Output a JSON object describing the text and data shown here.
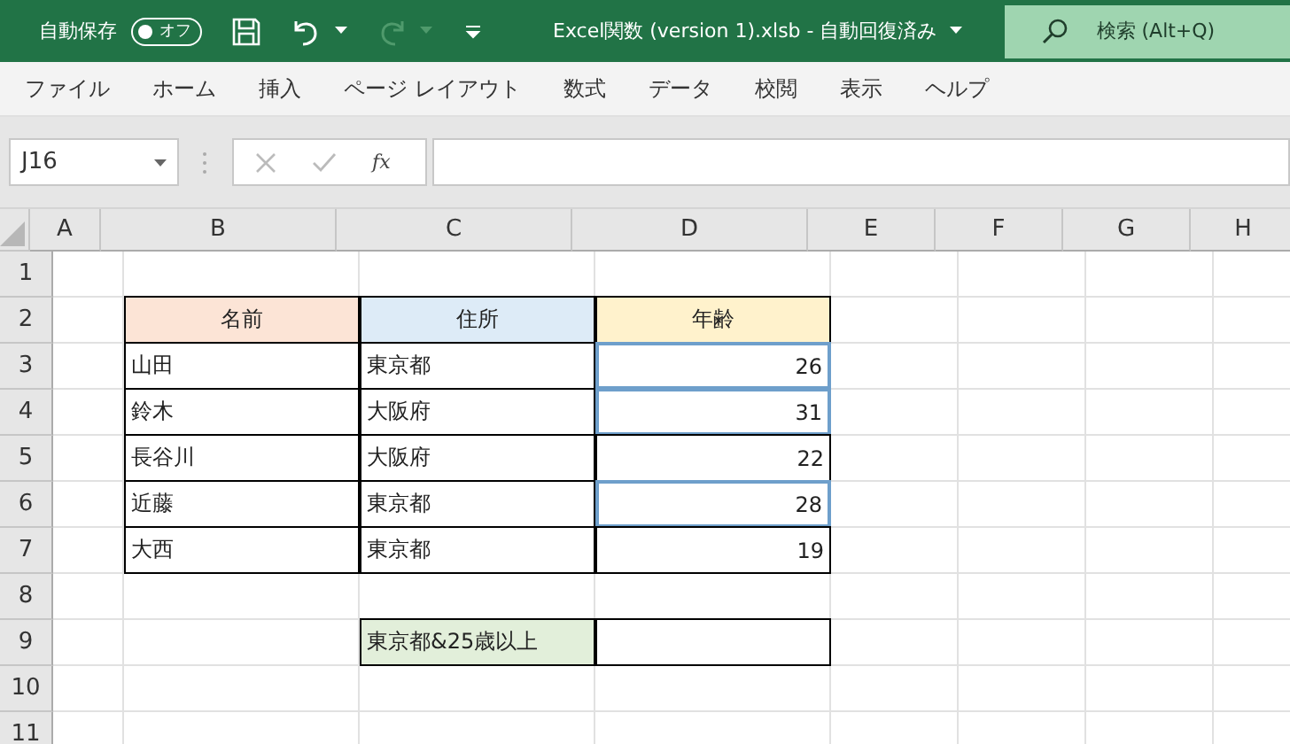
{
  "title_bar": {
    "autosave": {
      "label": "自動保存",
      "on": false,
      "state_text": "オフ"
    },
    "redo": {
      "disabled": true
    },
    "title": "Excel関数 (version 1).xlsb  -  自動回復済み",
    "search": {
      "placeholder": "検索 (Alt+Q)"
    }
  },
  "ribbon_tabs": [
    "ファイル",
    "ホーム",
    "挿入",
    "ページ レイアウト",
    "数式",
    "データ",
    "校閲",
    "表示",
    "ヘルプ"
  ],
  "formula_bar": {
    "name_box": "J16",
    "function_button": "fx"
  },
  "sheet": {
    "columns": [
      "A",
      "B",
      "C",
      "D",
      "E",
      "F",
      "G",
      "H"
    ],
    "row_labels": [
      "1",
      "2",
      "3",
      "4",
      "5",
      "6",
      "7",
      "8",
      "9",
      "10",
      "11"
    ],
    "table": {
      "header": [
        {
          "text": "名前",
          "color": "#fce4d6"
        },
        {
          "text": "住所",
          "color": "#ddebf7"
        },
        {
          "text": "年齢",
          "color": "#fff2cc"
        }
      ],
      "rows": [
        {
          "name": "山田",
          "address": "東京都",
          "age": "26",
          "highlighted": true
        },
        {
          "name": "鈴木",
          "address": "大阪府",
          "age": "31",
          "highlighted": true
        },
        {
          "name": "長谷川",
          "address": "大阪府",
          "age": "22",
          "highlighted": false
        },
        {
          "name": "近藤",
          "address": "東京都",
          "age": "28",
          "highlighted": true
        },
        {
          "name": "大西",
          "address": "東京都",
          "age": "19",
          "highlighted": false
        }
      ]
    },
    "criteria": {
      "label": "東京都&25歳以上",
      "color": "#e2efda"
    }
  }
}
